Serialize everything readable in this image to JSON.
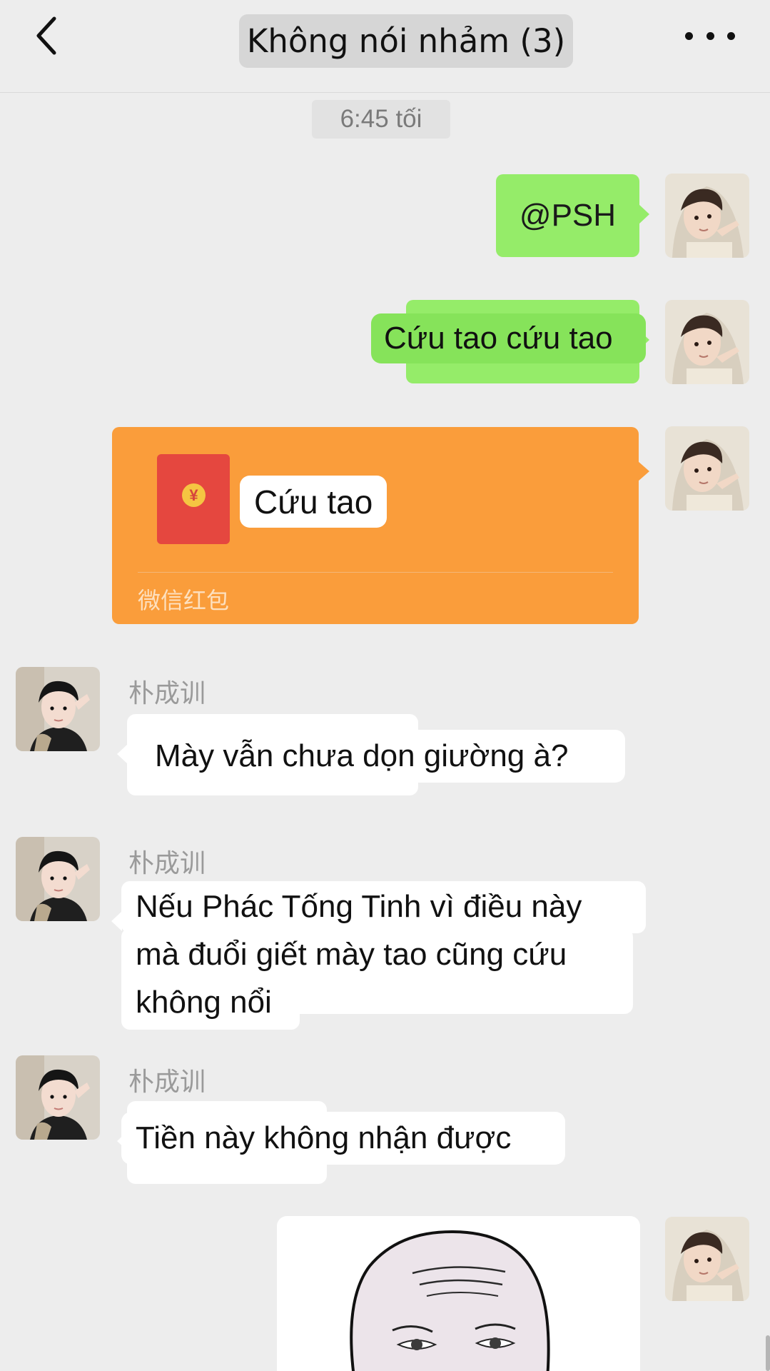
{
  "header": {
    "title": "Không nói nhảm (3)",
    "back_icon": "chevron-left-icon",
    "more_icon": "more-dots-icon"
  },
  "timestamp": "6:45 tối",
  "messages": [
    {
      "type": "text",
      "direction": "out",
      "text": "@PSH"
    },
    {
      "type": "text",
      "direction": "out",
      "text": "Cứu tao cứu tao"
    },
    {
      "type": "red_packet",
      "direction": "out",
      "text": "Cứu tao",
      "label": "微信红包",
      "icon": "red-envelope-icon"
    },
    {
      "type": "text",
      "direction": "in",
      "sender": "朴成训",
      "text": "Mày vẫn chưa dọn giường à?"
    },
    {
      "type": "text",
      "direction": "in",
      "sender": "朴成训",
      "lines": [
        "Nếu Phác Tống Tinh vì điều này",
        "mà đuổi giết mày tao cũng cứu",
        "không nổi"
      ]
    },
    {
      "type": "text",
      "direction": "in",
      "sender": "朴成训",
      "text": "Tiền này không nhận được"
    },
    {
      "type": "sticker",
      "direction": "out",
      "icon": "wojak-face-sticker"
    }
  ],
  "colors": {
    "background": "#ededed",
    "outgoing_bubble": "#95ec69",
    "incoming_bubble": "#ffffff",
    "red_packet": "#fa9d3b"
  }
}
